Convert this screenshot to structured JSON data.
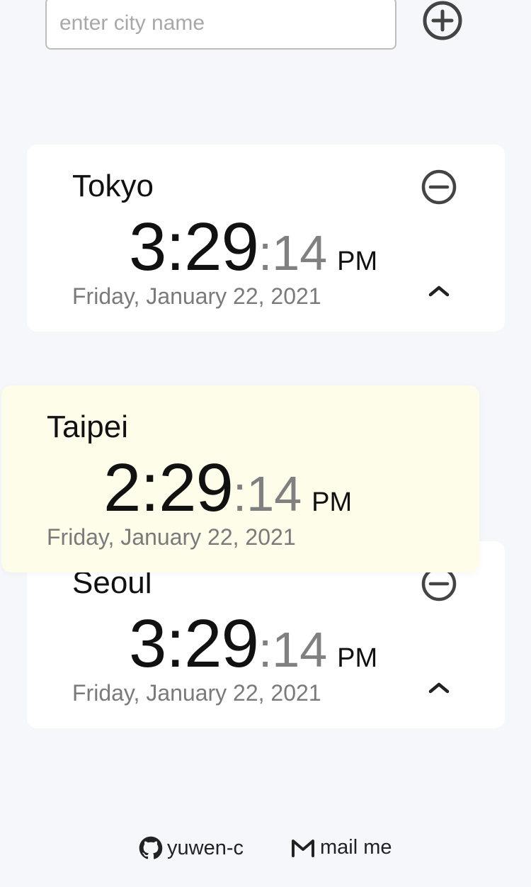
{
  "search": {
    "placeholder": "enter city name",
    "value": ""
  },
  "icons": {
    "add": "plus-circle-icon",
    "remove": "minus-circle-icon",
    "collapse": "chevron-up-icon",
    "github": "github-icon",
    "mail": "mail-icon"
  },
  "cards": [
    {
      "city": "Tokyo",
      "hm": "3:29",
      "sec": ":14",
      "ampm": "PM",
      "date": "Friday, January 22, 2021"
    },
    {
      "city": "Taipei",
      "hm": "2:29",
      "sec": ":14",
      "ampm": "PM",
      "date": "Friday, January 22, 2021"
    },
    {
      "city": "Seoul",
      "hm": "3:29",
      "sec": ":14",
      "ampm": "PM",
      "date": "Friday, January 22, 2021"
    }
  ],
  "footer": {
    "github_label": "yuwen-c",
    "mail_label": "mail me"
  },
  "colors": {
    "background": "#f5f7fb",
    "card": "#ffffff",
    "dragging_card": "#fefdea",
    "seconds": "#808080",
    "date": "#7a7a7a",
    "icon": "#444444"
  }
}
